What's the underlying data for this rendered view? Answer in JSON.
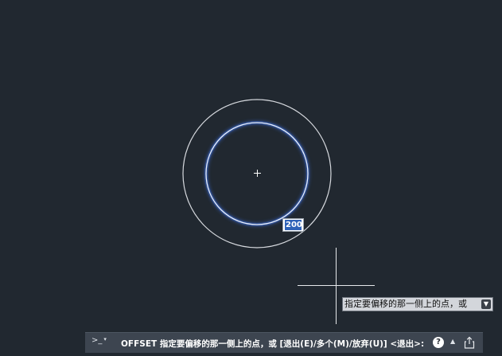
{
  "canvas": {
    "background": "#212830",
    "center_marker": "+",
    "inner_circle_color": "#4f7fe0",
    "outer_circle_color": "#d6d9de"
  },
  "dimension_input": {
    "value": "200"
  },
  "tooltip": {
    "text": "指定要偏移的那一侧上的点，或",
    "dropdown_icon": "dropdown-arrow-icon"
  },
  "command_line": {
    "prompt_symbol": ">_",
    "prompt_caret": "▾",
    "text": "OFFSET 指定要偏移的那一侧上的点，或 [退出(E)/多个(M)/放弃(U)] <退出>:",
    "help_label": "?",
    "recent_arrow": "▲",
    "share_icon": "share-icon"
  }
}
